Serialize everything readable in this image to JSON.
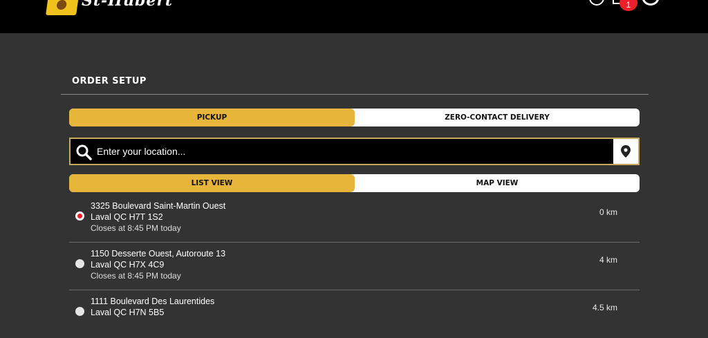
{
  "header": {
    "brand": "St-Hubert",
    "cart_count": "1",
    "accent": "#e6b53a",
    "badge_color": "#e8212b"
  },
  "order_setup": {
    "title": "ORDER SETUP",
    "mode_options": [
      "PICKUP",
      "ZERO-CONTACT DELIVERY"
    ],
    "selected_mode": "PICKUP"
  },
  "search": {
    "placeholder": "Enter your location...",
    "value": ""
  },
  "view_toggle": {
    "options": [
      "LIST VIEW",
      "MAP VIEW"
    ],
    "selected": "LIST VIEW"
  },
  "locations": [
    {
      "line1": "3325 Boulevard Saint-Martin Ouest",
      "line2": "Laval QC H7T 1S2",
      "hours": "Closes at 8:45 PM today",
      "distance": "0 km",
      "selected": true
    },
    {
      "line1": "1150 Desserte Ouest, Autoroute 13",
      "line2": "Laval QC H7X 4C9",
      "hours": "Closes at 8:45 PM today",
      "distance": "4 km",
      "selected": false
    },
    {
      "line1": "1111 Boulevard Des Laurentides",
      "line2": "Laval QC H7N 5B5",
      "hours": "",
      "distance": "4.5 km",
      "selected": false
    }
  ]
}
